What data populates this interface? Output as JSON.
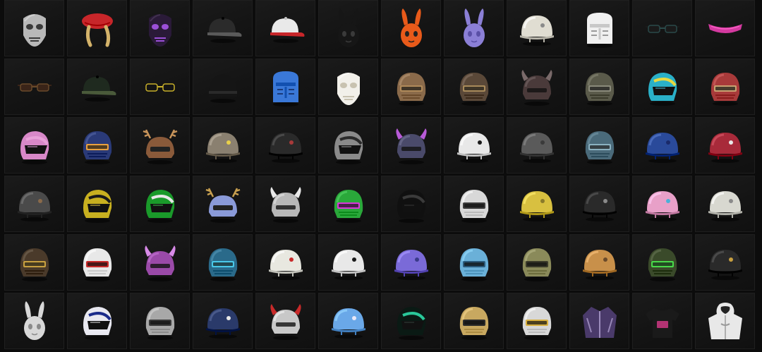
{
  "inventory": {
    "items": [
      {
        "icon": "skull-mask-icon",
        "kind": "mask",
        "main": "#b8b8b8",
        "accent": "#3a3a3a"
      },
      {
        "icon": "red-beret-braids-icon",
        "kind": "beret",
        "main": "#c8262a",
        "accent": "#d4b36a"
      },
      {
        "icon": "purple-face-mask-icon",
        "kind": "mask",
        "main": "#2a1a38",
        "accent": "#9b4fd8"
      },
      {
        "icon": "black-cap-icon",
        "kind": "cap",
        "main": "#2b2b2b",
        "accent": "#5a5a5a"
      },
      {
        "icon": "red-white-cap-icon",
        "kind": "cap",
        "main": "#e9e9e9",
        "accent": "#c8262a"
      },
      {
        "icon": "black-bunny-mask-icon",
        "kind": "bunny",
        "main": "#161616",
        "accent": "#3a3a3a"
      },
      {
        "icon": "orange-bunny-mask-icon",
        "kind": "bunny",
        "main": "#e85a1a",
        "accent": "#222222"
      },
      {
        "icon": "purple-bunny-mask-icon",
        "kind": "bunny",
        "main": "#8b7fd6",
        "accent": "#5a4fa6"
      },
      {
        "icon": "white-sailor-helmet-icon",
        "kind": "helmet",
        "main": "#e0ddd2",
        "accent": "#8a8a8a"
      },
      {
        "icon": "white-knight-helmet-icon",
        "kind": "knight",
        "main": "#f0f0f0",
        "accent": "#9a9a9a"
      },
      {
        "icon": "black-glasses-icon",
        "kind": "glasses",
        "main": "#1a1a1a",
        "accent": "#2a4a4a"
      },
      {
        "icon": "pink-visor-icon",
        "kind": "visor",
        "main": "#d43aa0",
        "accent": "#ff66cc"
      },
      {
        "icon": "aviator-sunglasses-icon",
        "kind": "glasses",
        "main": "#3a2418",
        "accent": "#6a4a2a"
      },
      {
        "icon": "dark-cap-icon",
        "kind": "cap",
        "main": "#1f2a1f",
        "accent": "#4a5a3a"
      },
      {
        "icon": "yellow-frame-glasses-icon",
        "kind": "glasses",
        "main": "#141414",
        "accent": "#c8b02a"
      },
      {
        "icon": "black-beanie-icon",
        "kind": "beanie",
        "main": "#151515",
        "accent": "#2a2a2a"
      },
      {
        "icon": "blue-knight-helmet-icon",
        "kind": "knight",
        "main": "#3a78d8",
        "accent": "#1a3a78"
      },
      {
        "icon": "white-cat-mask-icon",
        "kind": "mask",
        "main": "#f2f0ea",
        "accent": "#c8c2b0"
      },
      {
        "icon": "tan-level3-helmet-icon",
        "kind": "spetsnaz",
        "main": "#8a6a4a",
        "accent": "#b08a5a"
      },
      {
        "icon": "rusty-level3-helmet-icon",
        "kind": "spetsnaz",
        "main": "#5a4838",
        "accent": "#a88a5a"
      },
      {
        "icon": "horned-dark-helmet-icon",
        "kind": "horned",
        "main": "#4a3a3a",
        "accent": "#7a6a6a"
      },
      {
        "icon": "gray-level3-helmet-icon",
        "kind": "spetsnaz",
        "main": "#5a5a4a",
        "accent": "#8a8a7a"
      },
      {
        "icon": "cyan-striped-helmet-icon",
        "kind": "moto",
        "main": "#2ab0c8",
        "accent": "#e8d840"
      },
      {
        "icon": "red-level3-helmet-icon",
        "kind": "spetsnaz",
        "main": "#a83a3a",
        "accent": "#c8a070"
      },
      {
        "icon": "pink-icecream-helmet-icon",
        "kind": "moto",
        "main": "#d888c8",
        "accent": "#e8a0d8"
      },
      {
        "icon": "fighter-helmet-icon",
        "kind": "spetsnaz",
        "main": "#2a3a78",
        "accent": "#e8a040"
      },
      {
        "icon": "reindeer-helmet-icon",
        "kind": "antler",
        "main": "#8a5a3a",
        "accent": "#c8945a"
      },
      {
        "icon": "star-military-helmet-icon",
        "kind": "military",
        "main": "#8a8070",
        "accent": "#e8d04a"
      },
      {
        "icon": "dark-red-military-helmet-icon",
        "kind": "military",
        "main": "#2a2a2a",
        "accent": "#a83a3a"
      },
      {
        "icon": "silver-racing-helmet-icon",
        "kind": "moto",
        "main": "#8a8a8a",
        "accent": "#2a2a2a"
      },
      {
        "icon": "purple-demon-helmet-icon",
        "kind": "horned",
        "main": "#4a4a6a",
        "accent": "#b85ad8"
      },
      {
        "icon": "white-panda-helmet-icon",
        "kind": "military",
        "main": "#e8e8e8",
        "accent": "#1a1a1a"
      },
      {
        "icon": "gray-military-helmet-icon",
        "kind": "military",
        "main": "#5a5a5a",
        "accent": "#3a3a3a"
      },
      {
        "icon": "cracked-teal-helmet-icon",
        "kind": "spetsnaz",
        "main": "#4a6a7a",
        "accent": "#8ab0c0"
      },
      {
        "icon": "blue-military-helmet-icon",
        "kind": "military",
        "main": "#2a4a9a",
        "accent": "#1a2a6a"
      },
      {
        "icon": "red-camo-helmet-icon",
        "kind": "military",
        "main": "#a82a3a",
        "accent": "#e8e8e8"
      },
      {
        "icon": "gray-camo-helmet-icon",
        "kind": "military",
        "main": "#4a4a4a",
        "accent": "#8a6a4a"
      },
      {
        "icon": "yellow-racing-helmet-icon",
        "kind": "moto",
        "main": "#c8b020",
        "accent": "#1a1a1a"
      },
      {
        "icon": "green-racing-helmet-icon",
        "kind": "moto",
        "main": "#1a9a2a",
        "accent": "#e8e8e8"
      },
      {
        "icon": "blue-antler-helmet-icon",
        "kind": "antler",
        "main": "#8a9ad8",
        "accent": "#c8a050"
      },
      {
        "icon": "silver-viking-helmet-icon",
        "kind": "horned",
        "main": "#b8b8b8",
        "accent": "#e8e8e8"
      },
      {
        "icon": "graffiti-green-helmet-icon",
        "kind": "spetsnaz",
        "main": "#2aa83a",
        "accent": "#d83ad8"
      },
      {
        "icon": "black-glossy-helmet-icon",
        "kind": "moto",
        "main": "#101010",
        "accent": "#3a3a3a"
      },
      {
        "icon": "white-level3-helmet-icon",
        "kind": "spetsnaz",
        "main": "#d8d8d8",
        "accent": "#3a3a3a"
      },
      {
        "icon": "yellow-camo-helmet-icon",
        "kind": "military",
        "main": "#d8c040",
        "accent": "#8a7a2a"
      },
      {
        "icon": "black-graffiti-helmet-icon",
        "kind": "military",
        "main": "#2a2a2a",
        "accent": "#8a8a8a"
      },
      {
        "icon": "pastel-stripe-helmet-icon",
        "kind": "military",
        "main": "#e8a0c8",
        "accent": "#4ab0d8"
      },
      {
        "icon": "white-spiked-helmet-icon",
        "kind": "military",
        "main": "#d8d8d0",
        "accent": "#8a8a8a"
      },
      {
        "icon": "bronze-diver-helmet-icon",
        "kind": "spetsnaz",
        "main": "#4a3a2a",
        "accent": "#c8a040"
      },
      {
        "icon": "jester-helmet-icon",
        "kind": "spetsnaz",
        "main": "#e8e8e8",
        "accent": "#c82a2a"
      },
      {
        "icon": "violet-horn-helmet-icon",
        "kind": "horned",
        "main": "#9a4aa8",
        "accent": "#d88ae8"
      },
      {
        "icon": "teal-spiked-helmet-icon",
        "kind": "spetsnaz",
        "main": "#2a6a8a",
        "accent": "#4ac8e8"
      },
      {
        "icon": "white-red-helmet-icon",
        "kind": "military",
        "main": "#e8e8e0",
        "accent": "#c82a2a"
      },
      {
        "icon": "dalmatian-helmet-icon",
        "kind": "military",
        "main": "#e8e8e8",
        "accent": "#1a1a1a"
      },
      {
        "icon": "purple-camo-helmet-icon",
        "kind": "military",
        "main": "#7a6ad8",
        "accent": "#3a3a8a"
      },
      {
        "icon": "light-blue-level3-helmet-icon",
        "kind": "spetsnaz",
        "main": "#6ab0d8",
        "accent": "#2a5a7a"
      },
      {
        "icon": "olive-goggle-helmet-icon",
        "kind": "spetsnaz",
        "main": "#8a8a5a",
        "accent": "#3a3a2a"
      },
      {
        "icon": "tan-aviator-helmet-icon",
        "kind": "military",
        "main": "#c8904a",
        "accent": "#6a4a2a"
      },
      {
        "icon": "green-spike-helmet-icon",
        "kind": "spetsnaz",
        "main": "#3a4a2a",
        "accent": "#4ad84a"
      },
      {
        "icon": "studded-black-helmet-icon",
        "kind": "military",
        "main": "#2a2a2a",
        "accent": "#c8a040"
      },
      {
        "icon": "white-bunny-helmet-icon",
        "kind": "bunny",
        "main": "#d8d8d8",
        "accent": "#8a8a8a"
      },
      {
        "icon": "blue-white-racing-helmet-icon",
        "kind": "moto",
        "main": "#e8e8f0",
        "accent": "#1a2a8a"
      },
      {
        "icon": "silver-skull-helmet-icon",
        "kind": "spetsnaz",
        "main": "#a8a8a8",
        "accent": "#3a3a3a"
      },
      {
        "icon": "navy-aviator-helmet-icon",
        "kind": "military",
        "main": "#2a3a6a",
        "accent": "#e8e8e8"
      },
      {
        "icon": "red-horn-level3-helmet-icon",
        "kind": "horned",
        "main": "#c8c8c8",
        "accent": "#c82a2a"
      },
      {
        "icon": "sky-blue-helmet-icon",
        "kind": "military",
        "main": "#6aa8e8",
        "accent": "#e8e8f8"
      },
      {
        "icon": "dark-green-racing-helmet-icon",
        "kind": "moto",
        "main": "#0a1a14",
        "accent": "#2ac89a"
      },
      {
        "icon": "gold-level3-helmet-icon",
        "kind": "spetsnaz",
        "main": "#c8a860",
        "accent": "#2a2a2a"
      },
      {
        "icon": "laurel-level3-helmet-icon",
        "kind": "spetsnaz",
        "main": "#d8d8d8",
        "accent": "#d8b040"
      },
      {
        "icon": "purple-jacket-icon",
        "kind": "jacket",
        "main": "#4a3a6a",
        "accent": "#b8a8d8"
      },
      {
        "icon": "black-tshirt-icon",
        "kind": "tshirt",
        "main": "#1a1a1a",
        "accent": "#d83a8a"
      },
      {
        "icon": "white-hoodie-icon",
        "kind": "hoodie",
        "main": "#e8e8e8",
        "accent": "#9a9a9a"
      }
    ]
  }
}
